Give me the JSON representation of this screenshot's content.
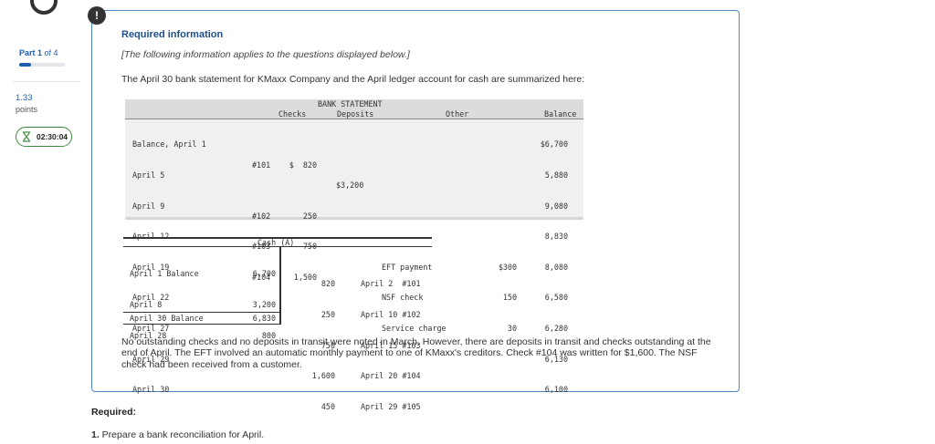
{
  "sidebar": {
    "part_prefix": "Part ",
    "part_current": "1",
    "part_sep": " of ",
    "part_total": "4",
    "progress_fraction": 0.25,
    "points_value": "1.33",
    "points_label": "points",
    "timer": "02:30:04"
  },
  "question": {
    "alert_glyph": "!",
    "heading": "Required information",
    "note": "[The following information applies to the questions displayed below.]",
    "intro": "The April 30 bank statement for KMaxx Company and the April ledger account for cash are summarized here:",
    "paragraph": "No outstanding checks and no deposits in transit were noted in March. However, there are deposits in transit and checks outstanding at the end of April. The EFT involved an automatic monthly payment to one of KMaxx's creditors. Check #104 was written for $1,600. The NSF check had been received from a customer.",
    "required_label": "Required:",
    "task_number": "1.",
    "task_text": " Prepare a bank reconciliation for April."
  },
  "bank_statement": {
    "title": "BANK STATEMENT",
    "headers": {
      "checks": "Checks",
      "deposits": "Deposits",
      "other": "Other",
      "balance": "Balance"
    },
    "dates": [
      "Balance, April 1",
      "April 5",
      "April 9",
      "April 12",
      "April 19",
      "April 22",
      "April 27",
      "April 29",
      "April 30"
    ],
    "check_numbers": [
      "",
      "#101",
      "",
      "#102",
      "#103",
      "#104",
      "",
      "",
      ""
    ],
    "check_amounts": [
      "",
      "$  820",
      "",
      "250",
      "750",
      "1,500",
      "",
      "",
      ""
    ],
    "deposits": [
      "",
      "",
      "$3,200",
      "",
      "",
      "",
      "",
      "",
      ""
    ],
    "other_desc": [
      "",
      "",
      "",
      "",
      "",
      "",
      "EFT payment",
      "NSF check",
      "Service charge"
    ],
    "other_amounts": [
      "",
      "",
      "",
      "",
      "",
      "",
      "$300",
      "150",
      "30"
    ],
    "balances": [
      "$6,700",
      "5,880",
      "9,080",
      "8,830",
      "8,080",
      "6,580",
      "6,280",
      "6,130",
      "6,100"
    ]
  },
  "ledger": {
    "title": "Cash (A)",
    "debit_labels": [
      "April 1 Balance",
      "April 8",
      "April 28"
    ],
    "debit_amounts": [
      "6,700",
      "3,200",
      "800"
    ],
    "credit_amounts": [
      "820",
      "250",
      "750",
      "1,600",
      "450"
    ],
    "credit_labels": [
      "April 2  #101",
      "April 10 #102",
      "April 15 #103",
      "April 20 #104",
      "April 29 #105"
    ],
    "ending_label": "April 30 Balance",
    "ending_amount": "6,830"
  }
}
